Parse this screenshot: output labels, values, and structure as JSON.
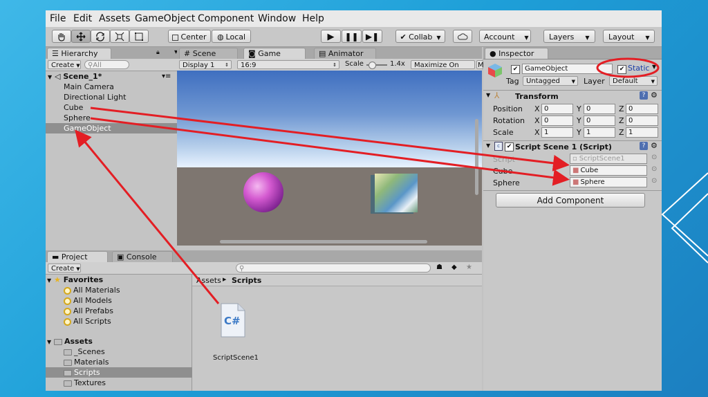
{
  "menu": [
    "File",
    "Edit",
    "Assets",
    "GameObject",
    "Component",
    "Window",
    "Help"
  ],
  "toolbar": {
    "pivot": "Center",
    "space": "Local",
    "collab": "Collab",
    "account": "Account",
    "layers": "Layers",
    "layout": "Layout"
  },
  "hierarchy": {
    "tab": "Hierarchy",
    "create": "Create",
    "search_placeholder": "All",
    "scene": "Scene_1*",
    "items": [
      "Main Camera",
      "Directional Light",
      "Cube",
      "Sphere",
      "GameObject"
    ]
  },
  "game": {
    "tabs": [
      "Scene",
      "Game",
      "Animator"
    ],
    "display": "Display 1",
    "aspect": "16:9",
    "scale_label": "Scale",
    "scale_value": "1.4x",
    "maximize": "Maximize On Play",
    "trailing": "M"
  },
  "inspector": {
    "tab": "Inspector",
    "object_name": "GameObject",
    "static": "Static",
    "tag_label": "Tag",
    "tag_value": "Untagged",
    "layer_label": "Layer",
    "layer_value": "Default",
    "transform": {
      "title": "Transform",
      "rows": [
        {
          "label": "Position",
          "x": "0",
          "y": "0",
          "z": "0"
        },
        {
          "label": "Rotation",
          "x": "0",
          "y": "0",
          "z": "0"
        },
        {
          "label": "Scale",
          "x": "1",
          "y": "1",
          "z": "1"
        }
      ]
    },
    "script": {
      "title": "Script Scene 1 (Script)",
      "script_label": "Script",
      "script_value": "ScriptScene1",
      "cube_label": "Cube",
      "cube_value": "Cube",
      "sphere_label": "Sphere",
      "sphere_value": "Sphere"
    },
    "add_component": "Add Component",
    "axes": [
      "X",
      "Y",
      "Z"
    ]
  },
  "project": {
    "tabs": [
      "Project",
      "Console"
    ],
    "create": "Create",
    "favorites": {
      "title": "Favorites",
      "items": [
        "All Materials",
        "All Models",
        "All Prefabs",
        "All Scripts"
      ]
    },
    "assets": {
      "title": "Assets",
      "items": [
        "_Scenes",
        "Materials",
        "Scripts",
        "Textures"
      ]
    },
    "breadcrumb": [
      "Assets",
      "Scripts"
    ],
    "file_label": "ScriptScene1",
    "file_glyph": "C#"
  },
  "colors": {
    "annotation": "#e31e24",
    "selection": "#8f8f8f",
    "background": "#1e9fd8"
  }
}
